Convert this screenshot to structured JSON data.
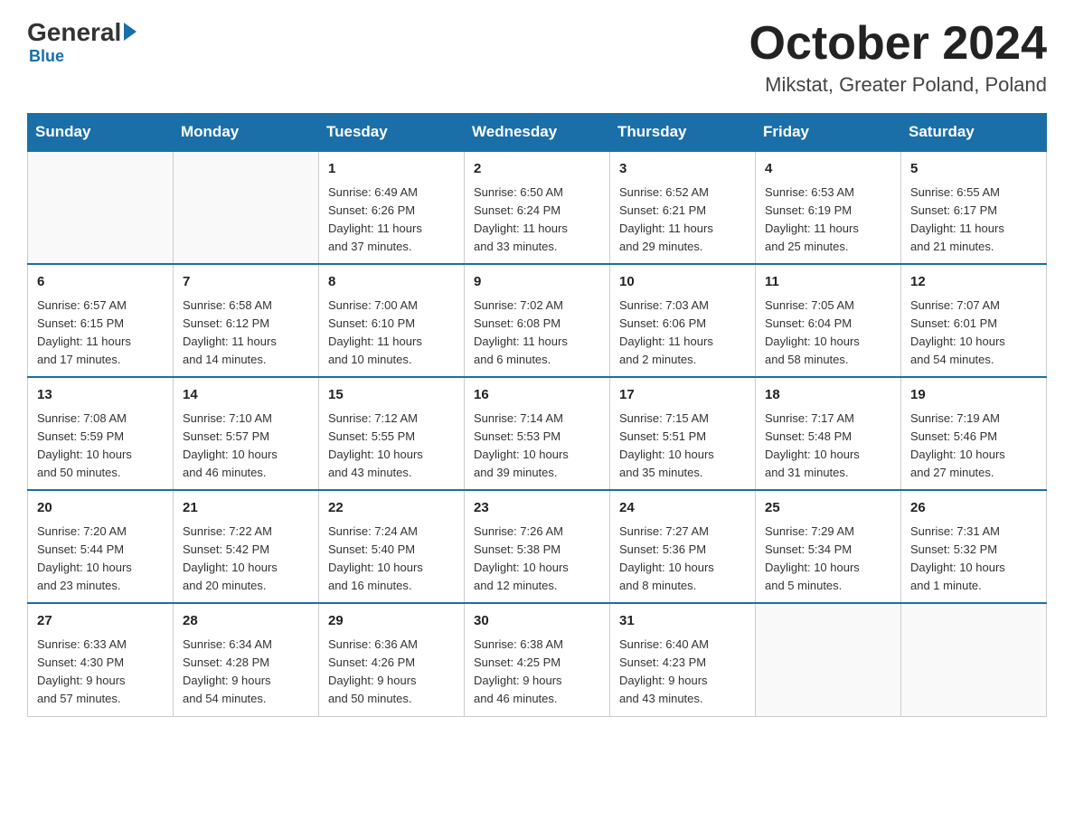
{
  "header": {
    "logo_general": "General",
    "logo_blue": "Blue",
    "month_title": "October 2024",
    "location": "Mikstat, Greater Poland, Poland"
  },
  "weekdays": [
    "Sunday",
    "Monday",
    "Tuesday",
    "Wednesday",
    "Thursday",
    "Friday",
    "Saturday"
  ],
  "weeks": [
    [
      {
        "day": "",
        "info": ""
      },
      {
        "day": "",
        "info": ""
      },
      {
        "day": "1",
        "info": "Sunrise: 6:49 AM\nSunset: 6:26 PM\nDaylight: 11 hours\nand 37 minutes."
      },
      {
        "day": "2",
        "info": "Sunrise: 6:50 AM\nSunset: 6:24 PM\nDaylight: 11 hours\nand 33 minutes."
      },
      {
        "day": "3",
        "info": "Sunrise: 6:52 AM\nSunset: 6:21 PM\nDaylight: 11 hours\nand 29 minutes."
      },
      {
        "day": "4",
        "info": "Sunrise: 6:53 AM\nSunset: 6:19 PM\nDaylight: 11 hours\nand 25 minutes."
      },
      {
        "day": "5",
        "info": "Sunrise: 6:55 AM\nSunset: 6:17 PM\nDaylight: 11 hours\nand 21 minutes."
      }
    ],
    [
      {
        "day": "6",
        "info": "Sunrise: 6:57 AM\nSunset: 6:15 PM\nDaylight: 11 hours\nand 17 minutes."
      },
      {
        "day": "7",
        "info": "Sunrise: 6:58 AM\nSunset: 6:12 PM\nDaylight: 11 hours\nand 14 minutes."
      },
      {
        "day": "8",
        "info": "Sunrise: 7:00 AM\nSunset: 6:10 PM\nDaylight: 11 hours\nand 10 minutes."
      },
      {
        "day": "9",
        "info": "Sunrise: 7:02 AM\nSunset: 6:08 PM\nDaylight: 11 hours\nand 6 minutes."
      },
      {
        "day": "10",
        "info": "Sunrise: 7:03 AM\nSunset: 6:06 PM\nDaylight: 11 hours\nand 2 minutes."
      },
      {
        "day": "11",
        "info": "Sunrise: 7:05 AM\nSunset: 6:04 PM\nDaylight: 10 hours\nand 58 minutes."
      },
      {
        "day": "12",
        "info": "Sunrise: 7:07 AM\nSunset: 6:01 PM\nDaylight: 10 hours\nand 54 minutes."
      }
    ],
    [
      {
        "day": "13",
        "info": "Sunrise: 7:08 AM\nSunset: 5:59 PM\nDaylight: 10 hours\nand 50 minutes."
      },
      {
        "day": "14",
        "info": "Sunrise: 7:10 AM\nSunset: 5:57 PM\nDaylight: 10 hours\nand 46 minutes."
      },
      {
        "day": "15",
        "info": "Sunrise: 7:12 AM\nSunset: 5:55 PM\nDaylight: 10 hours\nand 43 minutes."
      },
      {
        "day": "16",
        "info": "Sunrise: 7:14 AM\nSunset: 5:53 PM\nDaylight: 10 hours\nand 39 minutes."
      },
      {
        "day": "17",
        "info": "Sunrise: 7:15 AM\nSunset: 5:51 PM\nDaylight: 10 hours\nand 35 minutes."
      },
      {
        "day": "18",
        "info": "Sunrise: 7:17 AM\nSunset: 5:48 PM\nDaylight: 10 hours\nand 31 minutes."
      },
      {
        "day": "19",
        "info": "Sunrise: 7:19 AM\nSunset: 5:46 PM\nDaylight: 10 hours\nand 27 minutes."
      }
    ],
    [
      {
        "day": "20",
        "info": "Sunrise: 7:20 AM\nSunset: 5:44 PM\nDaylight: 10 hours\nand 23 minutes."
      },
      {
        "day": "21",
        "info": "Sunrise: 7:22 AM\nSunset: 5:42 PM\nDaylight: 10 hours\nand 20 minutes."
      },
      {
        "day": "22",
        "info": "Sunrise: 7:24 AM\nSunset: 5:40 PM\nDaylight: 10 hours\nand 16 minutes."
      },
      {
        "day": "23",
        "info": "Sunrise: 7:26 AM\nSunset: 5:38 PM\nDaylight: 10 hours\nand 12 minutes."
      },
      {
        "day": "24",
        "info": "Sunrise: 7:27 AM\nSunset: 5:36 PM\nDaylight: 10 hours\nand 8 minutes."
      },
      {
        "day": "25",
        "info": "Sunrise: 7:29 AM\nSunset: 5:34 PM\nDaylight: 10 hours\nand 5 minutes."
      },
      {
        "day": "26",
        "info": "Sunrise: 7:31 AM\nSunset: 5:32 PM\nDaylight: 10 hours\nand 1 minute."
      }
    ],
    [
      {
        "day": "27",
        "info": "Sunrise: 6:33 AM\nSunset: 4:30 PM\nDaylight: 9 hours\nand 57 minutes."
      },
      {
        "day": "28",
        "info": "Sunrise: 6:34 AM\nSunset: 4:28 PM\nDaylight: 9 hours\nand 54 minutes."
      },
      {
        "day": "29",
        "info": "Sunrise: 6:36 AM\nSunset: 4:26 PM\nDaylight: 9 hours\nand 50 minutes."
      },
      {
        "day": "30",
        "info": "Sunrise: 6:38 AM\nSunset: 4:25 PM\nDaylight: 9 hours\nand 46 minutes."
      },
      {
        "day": "31",
        "info": "Sunrise: 6:40 AM\nSunset: 4:23 PM\nDaylight: 9 hours\nand 43 minutes."
      },
      {
        "day": "",
        "info": ""
      },
      {
        "day": "",
        "info": ""
      }
    ]
  ]
}
